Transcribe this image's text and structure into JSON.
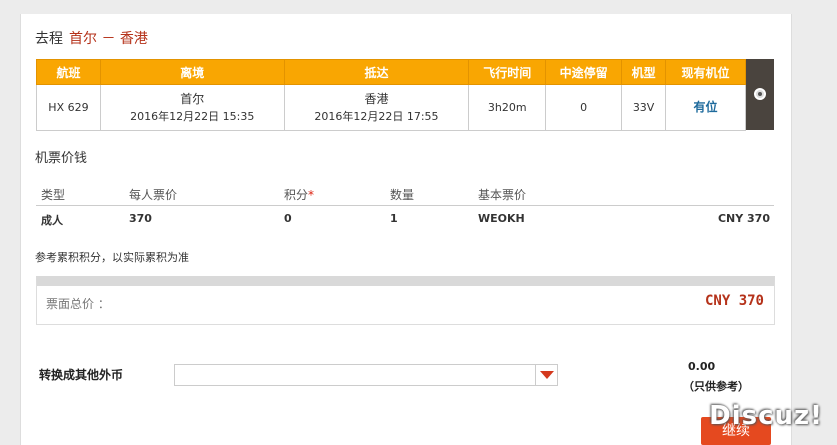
{
  "direction": {
    "label": "去程",
    "route": "首尔 － 香港"
  },
  "flight_table": {
    "headers": [
      "航班",
      "离境",
      "抵达",
      "飞行时间",
      "中途停留",
      "机型",
      "现有机位"
    ],
    "row": {
      "flight": "HX 629",
      "depart_city": "首尔",
      "depart_time": "2016年12月22日 15:35",
      "arrive_city": "香港",
      "arrive_time": "2016年12月22日 17:55",
      "duration": "3h20m",
      "stops": "0",
      "aircraft": "33V",
      "availability": "有位"
    }
  },
  "price": {
    "title": "机票价钱",
    "headers": {
      "type": "类型",
      "per_person": "每人票价",
      "points": "积分",
      "points_mark": "*",
      "qty": "数量",
      "base_fare": "基本票价"
    },
    "row": {
      "type": "成人",
      "per_person": "370",
      "points": "0",
      "qty": "1",
      "base_fare": "WEOKH",
      "amount": "CNY 370"
    },
    "note": "参考累积积分，以实际累积为准"
  },
  "total": {
    "label": "票面总价 ：",
    "value": "CNY 370"
  },
  "converter": {
    "label": "转换成其他外币",
    "selected": "",
    "amount": "0.00",
    "ref": "（只供参考）"
  },
  "continue_label": "继续",
  "watermark": "Discuz!",
  "colors": {
    "header_orange": "#f9a602",
    "accent_red": "#b5321a",
    "button": "#e5491f",
    "link_blue": "#1e6a9c"
  }
}
